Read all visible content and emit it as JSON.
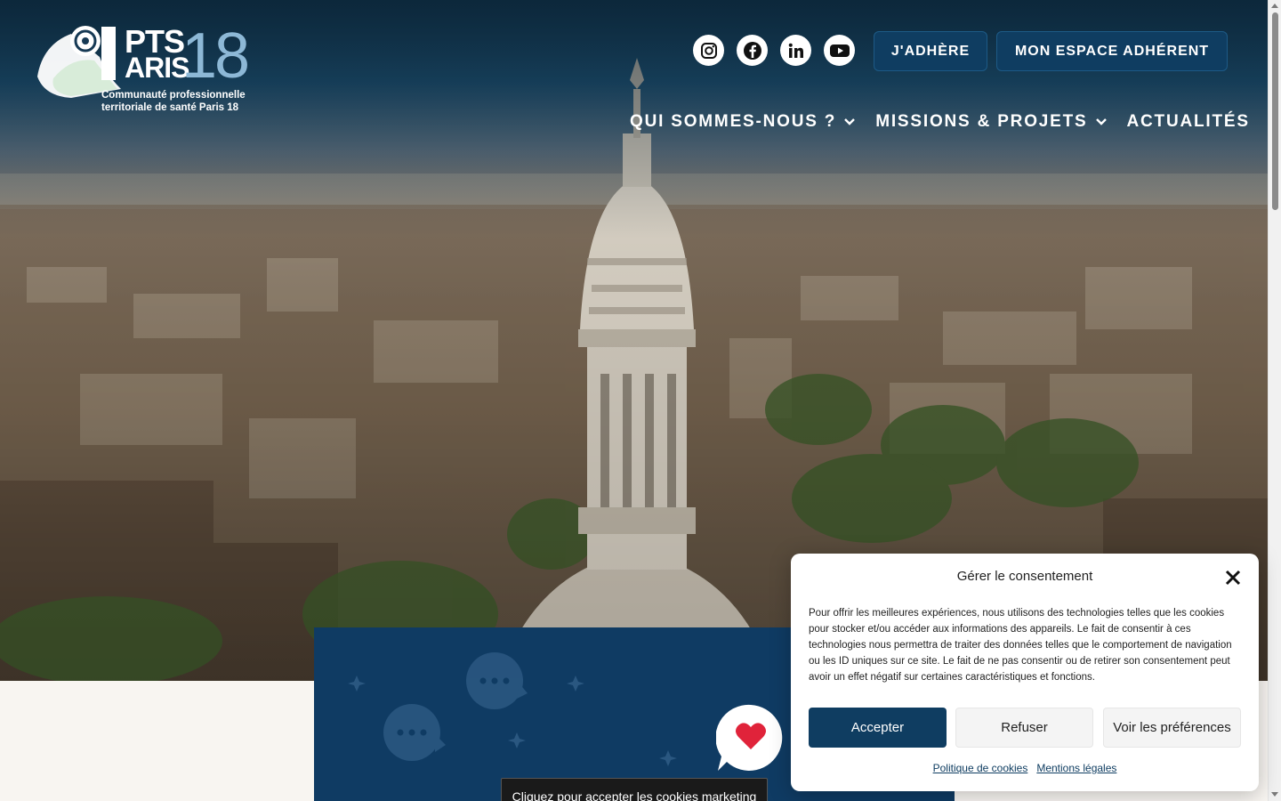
{
  "logo": {
    "word_line1": "PTS",
    "word_line2": "ARIS",
    "number": "18",
    "tagline_line1": "Communauté professionnelle",
    "tagline_line2": "territoriale de santé Paris 18"
  },
  "socials": [
    {
      "icon": "instagram-icon"
    },
    {
      "icon": "facebook-icon"
    },
    {
      "icon": "linkedin-icon"
    },
    {
      "icon": "youtube-icon"
    }
  ],
  "header": {
    "adhere_label": "J'ADHÈRE",
    "espace_label": "MON ESPACE ADHÉRENT"
  },
  "nav": {
    "items": [
      {
        "label": "QUI SOMMES-NOUS ?",
        "has_dropdown": true
      },
      {
        "label": "MISSIONS & PROJETS",
        "has_dropdown": true
      },
      {
        "label": "ACTUALITÉS",
        "has_dropdown": false
      }
    ]
  },
  "content": {
    "marketing_tip": "Cliquez pour accepter les cookies marketing"
  },
  "consent": {
    "title": "Gérer le consentement",
    "text": "Pour offrir les meilleures expériences, nous utilisons des technologies telles que les cookies pour stocker et/ou accéder aux informations des appareils. Le fait de consentir à ces technologies nous permettra de traiter des données telles que le comportement de navigation ou les ID uniques sur ce site. Le fait de ne pas consentir ou de retirer son consentement peut avoir un effet négatif sur certaines caractéristiques et fonctions.",
    "accept_label": "Accepter",
    "refuse_label": "Refuser",
    "prefs_label": "Voir les préférences",
    "link_cookies": "Politique de cookies",
    "link_legal": "Mentions légales"
  },
  "colors": {
    "primary": "#0f3d61",
    "accent": "#8db8d6",
    "card": "#0f3b63",
    "heart": "#e0233a"
  }
}
